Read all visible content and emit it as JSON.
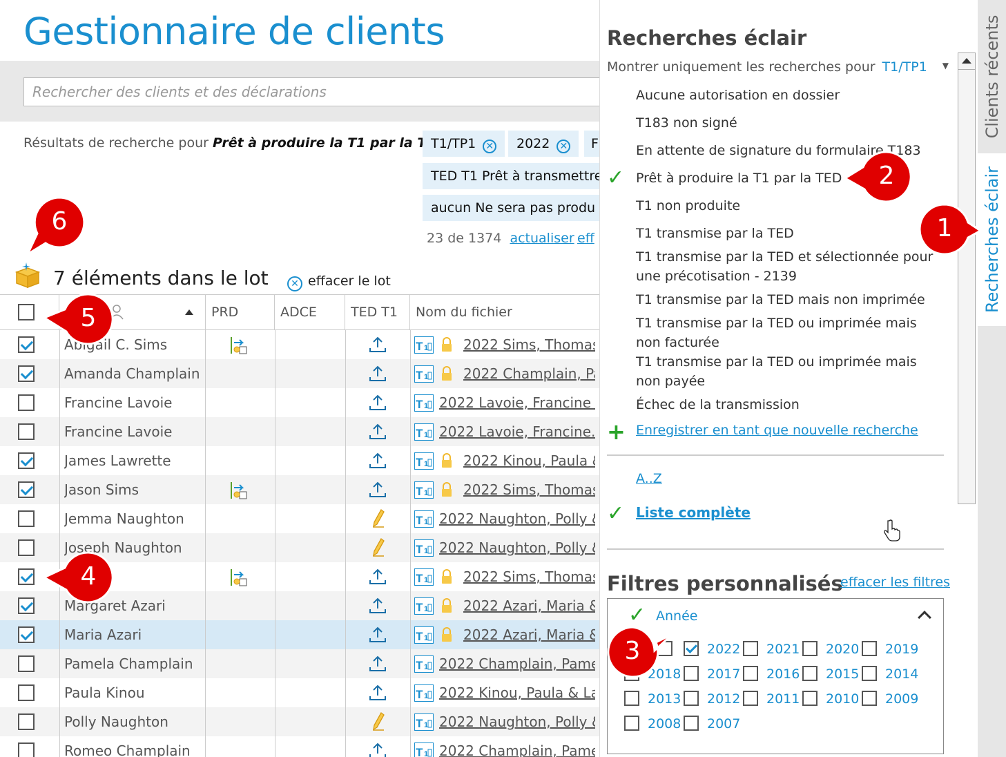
{
  "app_title": "Gestionnaire de clients",
  "search": {
    "placeholder": "Rechercher des clients et des déclarations"
  },
  "results": {
    "prefix": "Résultats de recherche pour",
    "query": "Prêt à produire la T1 par la TED",
    "chips": [
      "T1/TP1",
      "2022",
      "F",
      "TED T1 Prêt à transmettre",
      "aucun Ne sera pas produ"
    ],
    "count": "23 de 1374",
    "refresh": "actualiser",
    "more": "eff"
  },
  "batch": {
    "title": "7 éléments dans le lot",
    "clear": "effacer le lot"
  },
  "table": {
    "headers": [
      "PRD",
      "ADCE",
      "TED T1",
      "Nom du fichier"
    ],
    "rows": [
      {
        "name": "Abigail C. Sims",
        "checked": true,
        "prd": true,
        "ted": "up",
        "lock": true,
        "file": "2022 Sims, Thomas &"
      },
      {
        "name": "Amanda Champlain",
        "checked": true,
        "prd": false,
        "ted": "up",
        "lock": true,
        "file": "2022 Champlain, Pan"
      },
      {
        "name": "Francine Lavoie",
        "checked": false,
        "prd": false,
        "ted": "up",
        "lock": false,
        "file": "2022 Lavoie, Francine Ra"
      },
      {
        "name": "Francine Lavoie",
        "checked": false,
        "prd": false,
        "ted": "up",
        "lock": false,
        "file": "2022 Lavoie, Francine.20"
      },
      {
        "name": "James Lawrette",
        "checked": true,
        "prd": false,
        "ted": "up",
        "lock": true,
        "file": "2022 Kinou, Paula &"
      },
      {
        "name": "Jason Sims",
        "checked": true,
        "prd": true,
        "ted": "up",
        "lock": true,
        "file": "2022 Sims, Thomas &"
      },
      {
        "name": "Jemma Naughton",
        "checked": false,
        "prd": false,
        "ted": "pen",
        "lock": false,
        "file": "2022 Naughton, Polly &"
      },
      {
        "name": "Joseph Naughton",
        "checked": false,
        "prd": false,
        "ted": "pen",
        "lock": false,
        "file": "2022 Naughton, Polly &"
      },
      {
        "name": "ns",
        "checked": true,
        "prd": true,
        "ted": "up",
        "lock": true,
        "file": "2022 Sims, Thomas &"
      },
      {
        "name": "Margaret Azari",
        "checked": true,
        "prd": false,
        "ted": "up",
        "lock": true,
        "file": "2022 Azari, Maria &..."
      },
      {
        "name": "Maria Azari",
        "checked": true,
        "prd": false,
        "ted": "up",
        "lock": true,
        "file": "2022 Azari, Maria &...",
        "selected": true
      },
      {
        "name": "Pamela Champlain",
        "checked": false,
        "prd": false,
        "ted": "up",
        "lock": false,
        "file": "2022 Champlain, Pamela"
      },
      {
        "name": "Paula Kinou",
        "checked": false,
        "prd": false,
        "ted": "up",
        "lock": false,
        "file": "2022 Kinou, Paula & Law"
      },
      {
        "name": "Polly Naughton",
        "checked": false,
        "prd": false,
        "ted": "pen",
        "lock": false,
        "file": "2022 Naughton, Polly &"
      },
      {
        "name": "Romeo Champlain",
        "checked": false,
        "prd": false,
        "ted": "up",
        "lock": false,
        "file": "2022 Champlain, Pamela"
      }
    ]
  },
  "quick_search": {
    "title": "Recherches éclair",
    "show_only_label": "Montrer uniquement les recherches pour",
    "show_only_value": "T1/TP1",
    "items": [
      "Aucune autorisation en dossier",
      "T183 non signé",
      "En attente de signature du formulaire T183",
      "Prêt à produire la T1 par la TED",
      "T1 non produite",
      "T1 transmise par la TED",
      "T1 transmise par la TED et sélectionnée pour une précotisation - 2139",
      "T1 transmise par la TED mais non imprimée",
      "T1 transmise par la TED ou imprimée mais non facturée",
      "T1 transmise par la TED ou imprimée mais non payée",
      "Échec de la transmission"
    ],
    "save_new": "Enregistrer en tant que nouvelle recherche",
    "az": "A..Z",
    "full_list": "Liste complète"
  },
  "filters": {
    "title": "Filtres personnalisés",
    "clear": "effacer les filtres",
    "year_label": "Année",
    "years": [
      {
        "y": "3",
        "on": false
      },
      {
        "y": "2022",
        "on": true
      },
      {
        "y": "2021",
        "on": false
      },
      {
        "y": "2020",
        "on": false
      },
      {
        "y": "2019",
        "on": false
      },
      {
        "y": "2018",
        "on": false
      },
      {
        "y": "2017",
        "on": false
      },
      {
        "y": "2016",
        "on": false
      },
      {
        "y": "2015",
        "on": false
      },
      {
        "y": "2014",
        "on": false
      },
      {
        "y": "2013",
        "on": false
      },
      {
        "y": "2012",
        "on": false
      },
      {
        "y": "2011",
        "on": false
      },
      {
        "y": "2010",
        "on": false
      },
      {
        "y": "2009",
        "on": false
      },
      {
        "y": "2008",
        "on": false
      },
      {
        "y": "2007",
        "on": false
      }
    ]
  },
  "side_tabs": {
    "recent": "Clients récents",
    "quick": "Recherches éclair"
  },
  "callouts": [
    "1",
    "2",
    "3",
    "4",
    "5",
    "6"
  ],
  "colors": {
    "accent": "#1a8fcf",
    "check": "#2aa42a",
    "callout": "#e00000",
    "selected_row": "#d6e9f6"
  }
}
